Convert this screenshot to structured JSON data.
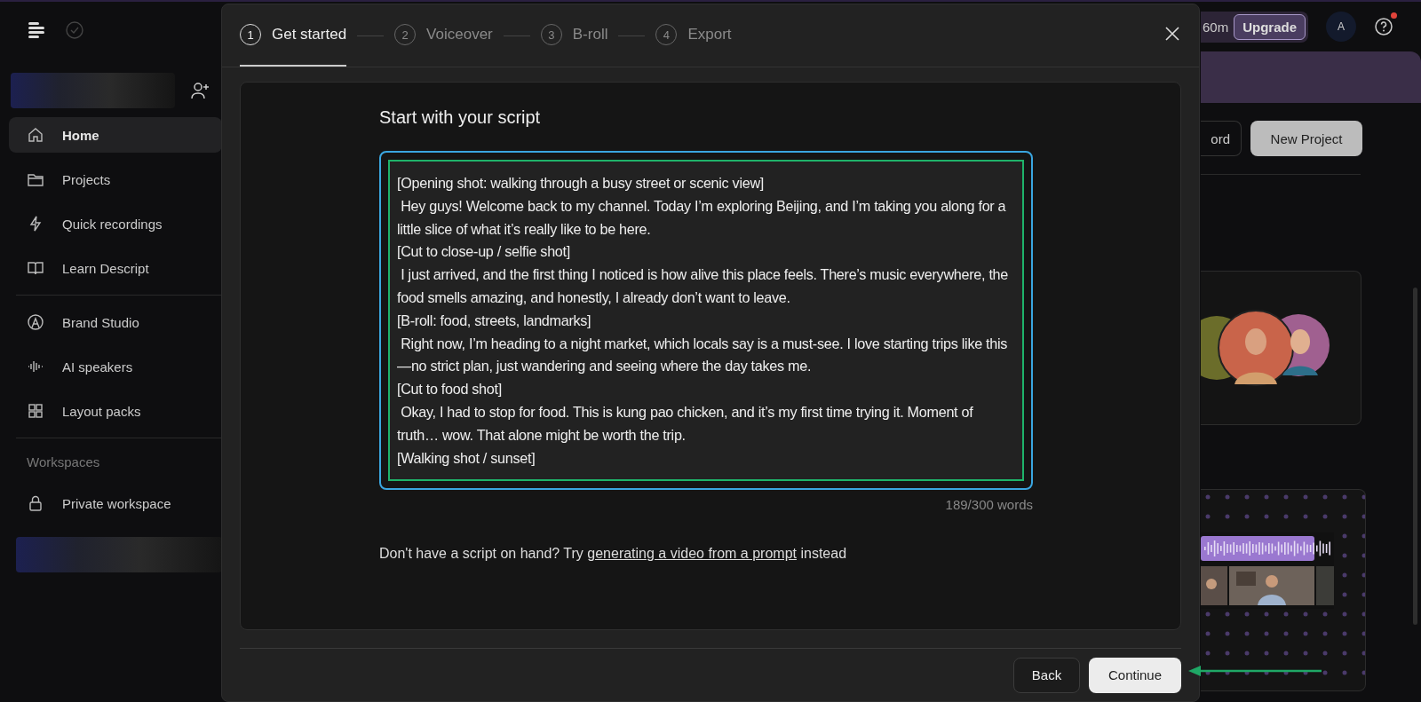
{
  "sidebar": {
    "groups": [
      [
        {
          "label": "Home",
          "selected": true
        },
        {
          "label": "Projects",
          "selected": false
        },
        {
          "label": "Quick recordings",
          "selected": false
        },
        {
          "label": "Learn Descript",
          "selected": false
        }
      ],
      [
        {
          "label": "Brand Studio",
          "selected": false
        },
        {
          "label": "AI speakers",
          "selected": false
        },
        {
          "label": "Layout packs",
          "selected": false
        }
      ]
    ],
    "workspaces_heading": "Workspaces",
    "workspaces": [
      {
        "label": "Private workspace",
        "selected": false
      }
    ]
  },
  "header": {
    "usage": "60m",
    "upgrade": "Upgrade",
    "avatar": "A",
    "help_notification": true
  },
  "toolbar": {
    "record": "ord",
    "new_project": "New Project"
  },
  "dialog": {
    "steps": [
      {
        "number": "1",
        "label": "Get started",
        "selected": true
      },
      {
        "number": "2",
        "label": "Voiceover",
        "selected": false
      },
      {
        "number": "3",
        "label": "B-roll",
        "selected": false
      },
      {
        "number": "4",
        "label": "Export",
        "selected": false
      }
    ],
    "heading": "Start with your script",
    "script": {
      "value": "[Opening shot: walking through a busy street or scenic view]\n Hey guys! Welcome back to my channel. Today I’m exploring Beijing, and I’m taking you along for a little slice of what it’s really like to be here.\n[Cut to close-up / selfie shot]\n I just arrived, and the first thing I noticed is how alive this place feels. There’s music everywhere, the food smells amazing, and honestly, I already don’t want to leave.\n[B-roll: food, streets, landmarks]\n Right now, I’m heading to a night market, which locals say is a must-see. I love starting trips like this—no strict plan, just wandering and seeing where the day takes me.\n[Cut to food shot]\n Okay, I had to stop for food. This is kung pao chicken, and it’s my first time trying it. Moment of truth… wow. That alone might be worth the trip.\n[Walking shot / sunset]",
      "focused": true
    },
    "word_count": "189/300 words",
    "hint": {
      "before": "Don't have a script on hand? Try",
      "link": "generating a video from a prompt",
      "after": "instead"
    },
    "buttons": {
      "back": "Back",
      "continue": "Continue"
    }
  },
  "annotations": {
    "script_highlight": true,
    "continue_arrow": true
  }
}
